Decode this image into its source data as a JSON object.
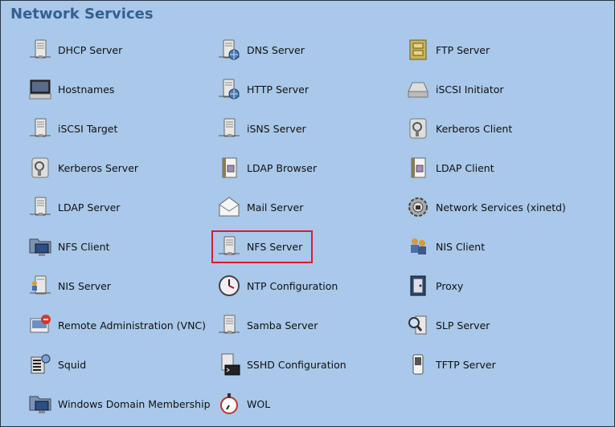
{
  "header": {
    "title": "Network Services"
  },
  "selected_item": "NFS Server",
  "columns": [
    [
      {
        "label": "DHCP Server",
        "icon": "server-icon"
      },
      {
        "label": "Hostnames",
        "icon": "monitor-icon"
      },
      {
        "label": "iSCSI Target",
        "icon": "server-icon"
      },
      {
        "label": "Kerberos Server",
        "icon": "lock-icon"
      },
      {
        "label": "LDAP Server",
        "icon": "server-icon"
      },
      {
        "label": "NFS Client",
        "icon": "folder-monitor-icon"
      },
      {
        "label": "NIS Server",
        "icon": "server-user-icon"
      },
      {
        "label": "Remote Administration (VNC)",
        "icon": "remote-icon"
      },
      {
        "label": "Squid",
        "icon": "squid-icon"
      },
      {
        "label": "Windows Domain Membership",
        "icon": "folder-monitor-icon"
      }
    ],
    [
      {
        "label": "DNS Server",
        "icon": "server-globe-icon"
      },
      {
        "label": "HTTP Server",
        "icon": "server-globe-icon"
      },
      {
        "label": "iSNS Server",
        "icon": "server-icon"
      },
      {
        "label": "LDAP Browser",
        "icon": "book-icon"
      },
      {
        "label": "Mail Server",
        "icon": "mail-icon"
      },
      {
        "label": "NFS Server",
        "icon": "server-icon"
      },
      {
        "label": "NTP Configuration",
        "icon": "clock-icon"
      },
      {
        "label": "Samba Server",
        "icon": "server-icon"
      },
      {
        "label": "SSHD Configuration",
        "icon": "terminal-icon"
      },
      {
        "label": "WOL",
        "icon": "alarm-icon"
      }
    ],
    [
      {
        "label": "FTP Server",
        "icon": "cabinet-icon"
      },
      {
        "label": "iSCSI Initiator",
        "icon": "disk-icon"
      },
      {
        "label": "Kerberos Client",
        "icon": "lock-icon"
      },
      {
        "label": "LDAP Client",
        "icon": "book-icon"
      },
      {
        "label": "Network Services (xinetd)",
        "icon": "gear-icon"
      },
      {
        "label": "NIS Client",
        "icon": "users-icon"
      },
      {
        "label": "Proxy",
        "icon": "door-icon"
      },
      {
        "label": "SLP Server",
        "icon": "search-server-icon"
      },
      {
        "label": "TFTP Server",
        "icon": "phone-icon"
      }
    ]
  ],
  "colors": {
    "background": "#a9c8ea",
    "title": "#35608f",
    "selection": "#d3202a"
  }
}
